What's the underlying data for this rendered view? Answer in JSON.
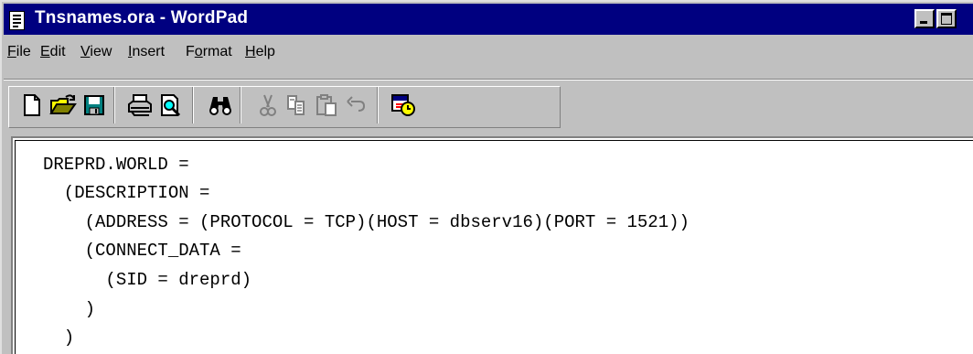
{
  "window": {
    "title": "Tnsnames.ora - WordPad"
  },
  "menu": {
    "items": [
      {
        "label": "File",
        "accel": "F",
        "rest": "ile"
      },
      {
        "label": "Edit",
        "accel": "E",
        "rest": "dit"
      },
      {
        "label": "View",
        "accel": "V",
        "rest": "iew"
      },
      {
        "label": "Insert",
        "accel": "I",
        "rest": "nsert"
      },
      {
        "label": "Format",
        "pre": "F",
        "accel": "o",
        "rest": "rmat"
      },
      {
        "label": "Help",
        "accel": "H",
        "rest": "elp"
      }
    ]
  },
  "toolbar": {
    "buttons": [
      {
        "icon": "new-document-icon",
        "enabled": true
      },
      {
        "icon": "open-folder-icon",
        "enabled": true
      },
      {
        "icon": "save-disk-icon",
        "enabled": true
      },
      {
        "icon": "print-icon",
        "enabled": true
      },
      {
        "icon": "print-preview-icon",
        "enabled": true
      },
      {
        "icon": "find-binoculars-icon",
        "enabled": true
      },
      {
        "icon": "cut-scissors-icon",
        "enabled": false
      },
      {
        "icon": "copy-icon",
        "enabled": false
      },
      {
        "icon": "paste-icon",
        "enabled": false
      },
      {
        "icon": "undo-icon",
        "enabled": false
      },
      {
        "icon": "date-time-icon",
        "enabled": true
      }
    ]
  },
  "document": {
    "lines": [
      "DREPRD.WORLD =",
      "  (DESCRIPTION =",
      "    (ADDRESS = (PROTOCOL = TCP)(HOST = dbserv16)(PORT = 1521))",
      "    (CONNECT_DATA =",
      "      (SID = dreprd)",
      "    )",
      "  )"
    ]
  },
  "colors": {
    "title_bar": "#000080",
    "chrome": "#c0c0c0",
    "document_bg": "#ffffff"
  }
}
